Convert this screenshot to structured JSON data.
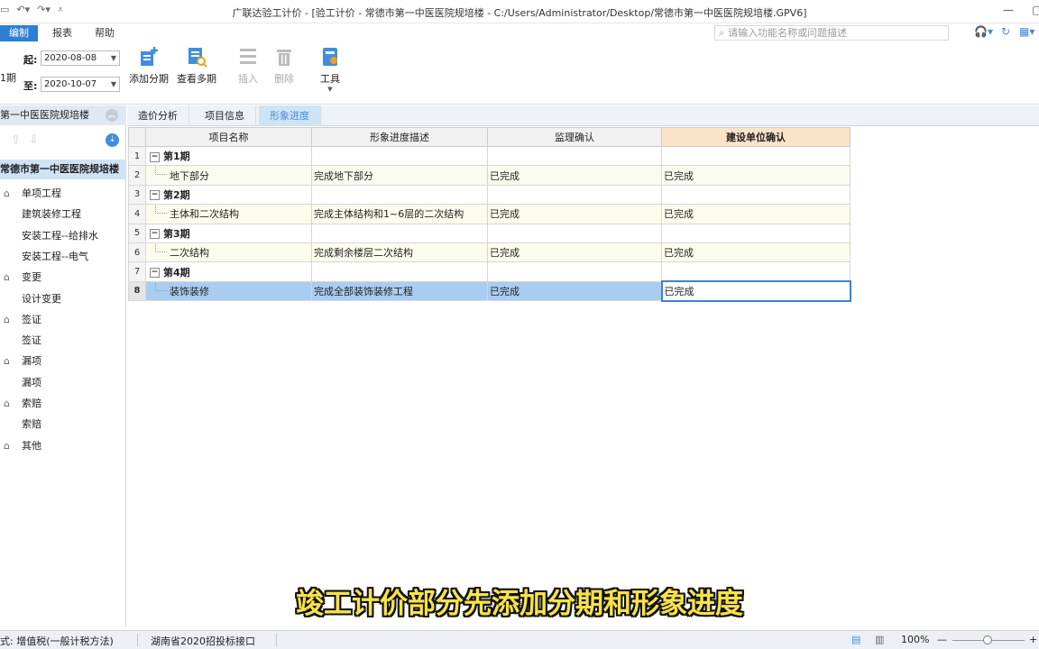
{
  "titlebar": {
    "title": "广联达验工计价 - [验工计价 - 常德市第一中医医院规培楼 - C:/Users/Administrator/Desktop/常德市第一中医医院规培楼.GPV6]"
  },
  "menubar": {
    "items": [
      "编制",
      "报表",
      "帮助"
    ],
    "search_placeholder": "请输入功能名称或问题描述"
  },
  "ribbon": {
    "period_label": "1期",
    "start_label": "起:",
    "start_date": "2020-08-08",
    "end_label": "至:",
    "end_date": "2020-10-07",
    "buttons": {
      "add": "添加分期",
      "view": "查看多期",
      "insert": "插入",
      "delete": "删除",
      "tools": "工具"
    }
  },
  "leftpanel": {
    "header": "第一中医医院规培楼",
    "root": "常德市第一中医医院规培楼",
    "items": [
      {
        "label": "单项工程",
        "group": true
      },
      {
        "label": "建筑装修工程",
        "group": false
      },
      {
        "label": "安装工程--给排水",
        "group": false
      },
      {
        "label": "安装工程--电气",
        "group": false
      },
      {
        "label": "变更",
        "group": true
      },
      {
        "label": "设计变更",
        "group": false
      },
      {
        "label": "签证",
        "group": true
      },
      {
        "label": "签证",
        "group": false
      },
      {
        "label": "漏项",
        "group": true
      },
      {
        "label": "漏项",
        "group": false
      },
      {
        "label": "索赔",
        "group": true
      },
      {
        "label": "索赔",
        "group": false
      },
      {
        "label": "其他",
        "group": true
      }
    ]
  },
  "tabs": [
    "造价分析",
    "项目信息",
    "形象进度"
  ],
  "grid": {
    "headers": [
      "项目名称",
      "形象进度描述",
      "监理确认",
      "建设单位确认"
    ],
    "rows": [
      {
        "no": "1",
        "name": "第1期",
        "desc": "",
        "supervisor": "",
        "owner": "",
        "type": "period"
      },
      {
        "no": "2",
        "name": "地下部分",
        "desc": "完成地下部分",
        "supervisor": "已完成",
        "owner": "已完成",
        "type": "child"
      },
      {
        "no": "3",
        "name": "第2期",
        "desc": "",
        "supervisor": "",
        "owner": "",
        "type": "period"
      },
      {
        "no": "4",
        "name": "主体和二次结构",
        "desc": "完成主体结构和1~6层的二次结构",
        "supervisor": "已完成",
        "owner": "已完成",
        "type": "child"
      },
      {
        "no": "5",
        "name": "第3期",
        "desc": "",
        "supervisor": "",
        "owner": "",
        "type": "period"
      },
      {
        "no": "6",
        "name": "二次结构",
        "desc": "完成剩余楼层二次结构",
        "supervisor": "已完成",
        "owner": "已完成",
        "type": "child"
      },
      {
        "no": "7",
        "name": "第4期",
        "desc": "",
        "supervisor": "",
        "owner": "",
        "type": "period"
      },
      {
        "no": "8",
        "name": "装饰装修",
        "desc": "完成全部装饰装修工程",
        "supervisor": "已完成",
        "owner": "已完成",
        "type": "child"
      }
    ]
  },
  "subtitle": "竣工计价部分先添加分期和形象进度",
  "statusbar": {
    "tax": "式: 增值税(一般计税方法)",
    "interface": "湖南省2020招投标接口",
    "zoom": "100%"
  },
  "colors": {
    "accent": "#2c7fd2",
    "header_highlight": "#fbe3c8",
    "selected_row": "#a9cdf1",
    "subtitle": "#f7e24a"
  }
}
